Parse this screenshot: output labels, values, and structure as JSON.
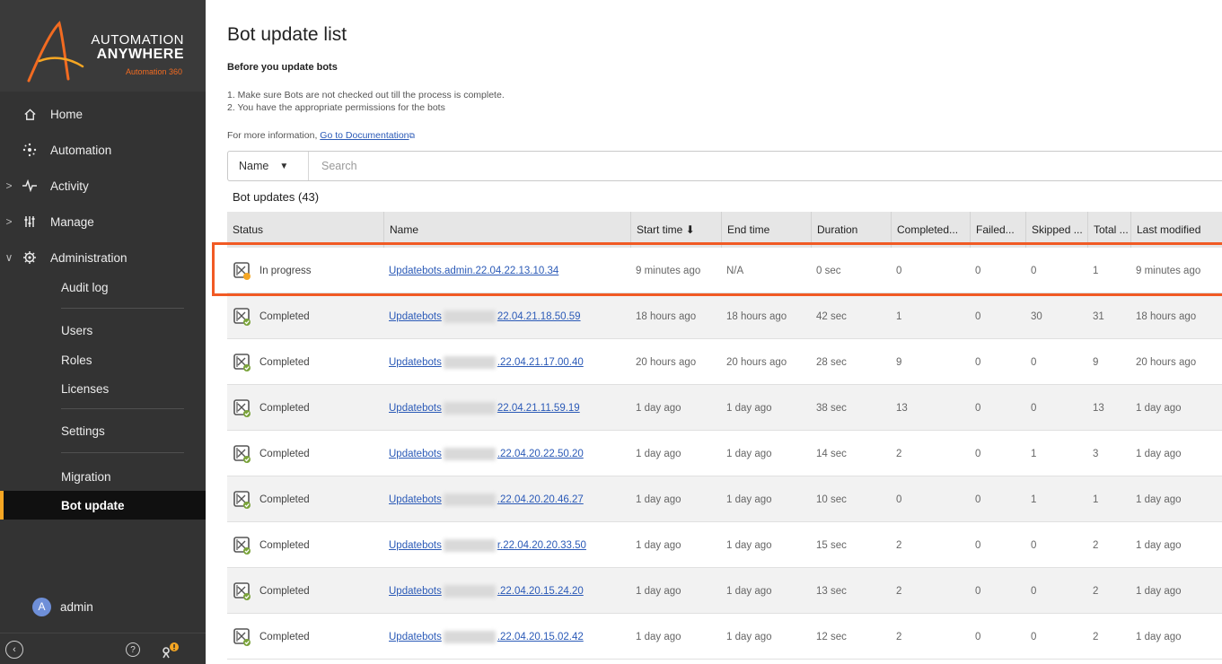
{
  "brand": {
    "line1": "AUTOMATION",
    "line2": "ANYWHERE",
    "line3": "Automation 360",
    "accent": "#f26b21"
  },
  "sidebar": {
    "nav": [
      {
        "label": "Home",
        "icon": "home-icon",
        "chevron": ""
      },
      {
        "label": "Automation",
        "icon": "automation-icon",
        "chevron": ""
      },
      {
        "label": "Activity",
        "icon": "activity-icon",
        "chevron": ">"
      },
      {
        "label": "Manage",
        "icon": "manage-icon",
        "chevron": ">"
      },
      {
        "label": "Administration",
        "icon": "gear-icon",
        "chevron": "∨"
      }
    ],
    "admin_items": {
      "audit_log": "Audit log",
      "users": "Users",
      "roles": "Roles",
      "licenses": "Licenses",
      "settings": "Settings",
      "migration": "Migration",
      "bot_update": "Bot update"
    },
    "user": {
      "avatar_letter": "A",
      "name": "admin"
    },
    "active_color": "#f5a623"
  },
  "page": {
    "title": "Bot update list",
    "pre_heading": "Before you update bots",
    "pre_items": [
      "1. Make sure Bots are not checked out till the process is complete.",
      "2. You have the appropriate permissions for the bots"
    ],
    "more_info_prefix": "For more information, ",
    "more_info_link": "Go to Documentation",
    "search": {
      "field": "Name",
      "placeholder": "Search"
    },
    "section_label": "Bot updates (43)"
  },
  "table": {
    "headers": {
      "status": "Status",
      "name": "Name",
      "start": "Start time ⬇",
      "end": "End time",
      "duration": "Duration",
      "completed": "Completed...",
      "failed": "Failed...",
      "skipped": "Skipped ...",
      "total": "Total ...",
      "modified": "Last modified"
    },
    "rows": [
      {
        "status": "In progress",
        "name_a": "Updatebots.admin.22.04.22.13.10.34",
        "name_b": "",
        "start": "9 minutes ago",
        "end": "N/A",
        "duration": "0 sec",
        "completed": "0",
        "failed": "0",
        "skipped": "0",
        "total": "1",
        "modified": "9 minutes ago"
      },
      {
        "status": "Completed",
        "name_a": "Updatebots",
        "name_b": "22.04.21.18.50.59",
        "start": "18 hours ago",
        "end": "18 hours ago",
        "duration": "42 sec",
        "completed": "1",
        "failed": "0",
        "skipped": "30",
        "total": "31",
        "modified": "18 hours ago"
      },
      {
        "status": "Completed",
        "name_a": "Updatebots",
        "name_b": ".22.04.21.17.00.40",
        "start": "20 hours ago",
        "end": "20 hours ago",
        "duration": "28 sec",
        "completed": "9",
        "failed": "0",
        "skipped": "0",
        "total": "9",
        "modified": "20 hours ago"
      },
      {
        "status": "Completed",
        "name_a": "Updatebots",
        "name_b": "22.04.21.11.59.19",
        "start": "1 day ago",
        "end": "1 day ago",
        "duration": "38 sec",
        "completed": "13",
        "failed": "0",
        "skipped": "0",
        "total": "13",
        "modified": "1 day ago"
      },
      {
        "status": "Completed",
        "name_a": "Updatebots",
        "name_b": ".22.04.20.22.50.20",
        "start": "1 day ago",
        "end": "1 day ago",
        "duration": "14 sec",
        "completed": "2",
        "failed": "0",
        "skipped": "1",
        "total": "3",
        "modified": "1 day ago"
      },
      {
        "status": "Completed",
        "name_a": "Updatebots",
        "name_b": ".22.04.20.20.46.27",
        "start": "1 day ago",
        "end": "1 day ago",
        "duration": "10 sec",
        "completed": "0",
        "failed": "0",
        "skipped": "1",
        "total": "1",
        "modified": "1 day ago"
      },
      {
        "status": "Completed",
        "name_a": "Updatebots",
        "name_b": "r.22.04.20.20.33.50",
        "start": "1 day ago",
        "end": "1 day ago",
        "duration": "15 sec",
        "completed": "2",
        "failed": "0",
        "skipped": "0",
        "total": "2",
        "modified": "1 day ago"
      },
      {
        "status": "Completed",
        "name_a": "Updatebots",
        "name_b": ".22.04.20.15.24.20",
        "start": "1 day ago",
        "end": "1 day ago",
        "duration": "13 sec",
        "completed": "2",
        "failed": "0",
        "skipped": "0",
        "total": "2",
        "modified": "1 day ago"
      },
      {
        "status": "Completed",
        "name_a": "Updatebots",
        "name_b": ".22.04.20.15.02.42",
        "start": "1 day ago",
        "end": "1 day ago",
        "duration": "12 sec",
        "completed": "2",
        "failed": "0",
        "skipped": "0",
        "total": "2",
        "modified": "1 day ago"
      }
    ]
  },
  "highlight_color": "#f15a24"
}
